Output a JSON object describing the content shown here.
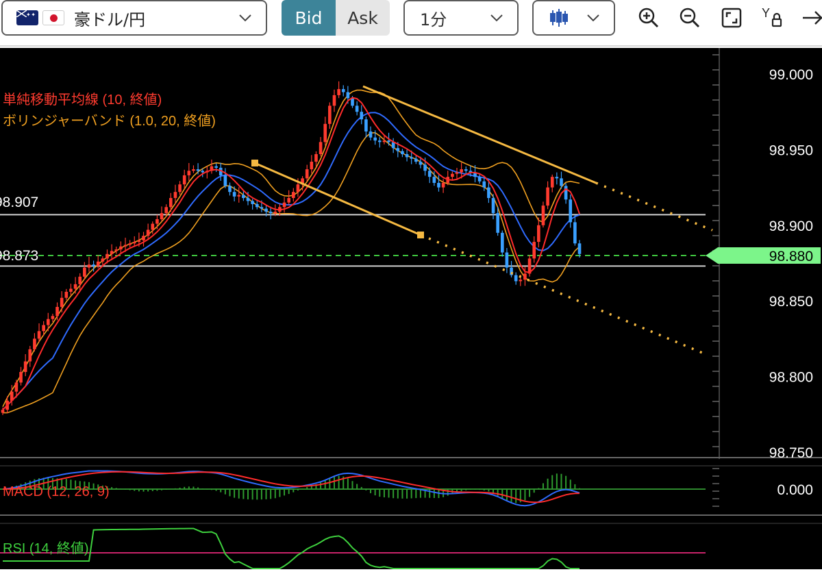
{
  "toolbar": {
    "symbol": "豪ドル/円",
    "bid_label": "Bid",
    "ask_label": "Ask",
    "timeframe": "1分",
    "icons": [
      "zoom-in-icon",
      "zoom-out-icon",
      "fullscreen-icon",
      "price-lock-icon",
      "arrow-right-icon"
    ]
  },
  "chart": {
    "indicators": {
      "sma": "単純移動平均線 (10, 終値)",
      "bollinger": "ボリンジャーバンド (1.0, 20, 終値)",
      "macd": "MACD (12, 26, 9)",
      "rsi": "RSI (14, 終値)"
    },
    "price_axis": [
      "99.000",
      "98.950",
      "98.900",
      "98.850",
      "98.800",
      "98.750"
    ],
    "level_upper": "98.907",
    "level_current_line": "98.873",
    "current_price": "98.880",
    "macd_axis": "0.000",
    "colors": {
      "background": "#000000",
      "candle_up": "#ff3b2f",
      "candle_down": "#3aa0ff",
      "sma": "#ff2b2b",
      "blue_ma": "#2f6bff",
      "bollinger": "#f0a020",
      "trendline": "#f5b942",
      "current_price_tag": "#7cf58a",
      "rsi_line": "#3ed13e",
      "rsi_level": "#c8246a"
    }
  },
  "chart_data": {
    "type": "candlestick",
    "ylim": [
      98.75,
      99.0
    ],
    "yticks": [
      99.0,
      98.95,
      98.9,
      98.85,
      98.8,
      98.75
    ],
    "horizontal_levels": [
      98.907,
      98.873
    ],
    "current_price": 98.88,
    "close": [
      98.778,
      98.784,
      98.79,
      98.796,
      98.803,
      98.81,
      98.818,
      98.825,
      98.83,
      98.834,
      98.838,
      98.84,
      98.846,
      98.852,
      98.856,
      98.858,
      98.861,
      98.866,
      98.872,
      98.874,
      98.873,
      98.876,
      98.878,
      98.881,
      98.883,
      98.884,
      98.886,
      98.887,
      98.888,
      98.889,
      98.89,
      98.893,
      98.897,
      98.901,
      98.904,
      98.908,
      98.912,
      98.918,
      98.922,
      98.927,
      98.933,
      98.936,
      98.937,
      98.936,
      98.935,
      98.936,
      98.939,
      98.938,
      98.933,
      98.926,
      98.922,
      98.919,
      98.92,
      98.918,
      98.916,
      98.914,
      98.912,
      98.911,
      98.909,
      98.908,
      98.909,
      98.912,
      98.915,
      98.918,
      98.922,
      98.927,
      98.931,
      98.937,
      98.942,
      98.947,
      98.955,
      98.967,
      98.979,
      98.986,
      98.99,
      98.988,
      98.984,
      98.979,
      98.975,
      98.97,
      98.962,
      98.958,
      98.956,
      98.955,
      98.956,
      98.955,
      98.951,
      98.949,
      98.947,
      98.945,
      98.944,
      98.942,
      98.94,
      98.936,
      98.932,
      98.928,
      98.925,
      98.928,
      98.932,
      98.934,
      98.935,
      98.937,
      98.936,
      98.935,
      98.932,
      98.929,
      98.925,
      98.918,
      98.908,
      98.895,
      98.882,
      98.872,
      98.867,
      98.863,
      98.864,
      98.868,
      98.878,
      98.889,
      98.9,
      98.913,
      98.925,
      98.932,
      98.931,
      98.926,
      98.917,
      98.902,
      98.888,
      98.881
    ]
  }
}
